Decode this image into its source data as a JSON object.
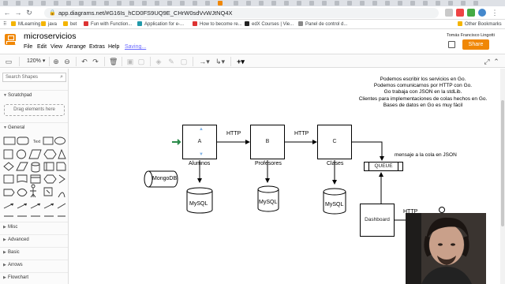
{
  "browser": {
    "url": "app.diagrams.net/#G16Is_hCD0FS9UQ9E_CHrW0sdVvWJtNQ4X",
    "bookmarks": [
      "MLearning",
      "java",
      "bet",
      "Fun with Function...",
      "Application for e-...",
      "How to become re...",
      "edX Courses | Vie...",
      "Panel de control d..."
    ],
    "other_bookmarks": "Other Bookmarks"
  },
  "app": {
    "title": "microservicios",
    "menu": [
      "File",
      "Edit",
      "View",
      "Arrange",
      "Extras",
      "Help"
    ],
    "saving": "Saving...",
    "user": "Tomás Francisco Lingotti",
    "share": "Share",
    "zoom": "120%"
  },
  "sidebar": {
    "search_placeholder": "Search Shapes",
    "scratchpad": "Scratchpad",
    "drag_here": "Drag elements here",
    "general": "General",
    "sections": [
      "Misc",
      "Advanced",
      "Basic",
      "Arrows",
      "Flowchart"
    ],
    "text_shape": "Text"
  },
  "diagram": {
    "node_a": "A",
    "node_b": "B",
    "node_c": "C",
    "label_a": "Alumnos",
    "label_b": "Profesores",
    "label_c": "Clases",
    "http_ab": "HTTP",
    "http_bc": "HTTP",
    "http_dash": "HTTP",
    "mongo": "MongoDB",
    "db1": "MySQL",
    "db2": "MySQL",
    "db3": "MySQL",
    "queue": "QUEUE",
    "queue_note": "mensaje a la cola en JSON",
    "dashboard": "Dashboard",
    "notes": [
      "Podemos escribir los servicios en Go.",
      "Podemos comunicarnos por HTTP con Go.",
      "Go trabaja con JSON en la stdLib.",
      "Clientes para implementaciones de colas hechos en Go.",
      "Bases de datos en Go es muy fácil"
    ]
  },
  "colors": {
    "accent": "#f08705",
    "link": "#6a6aff"
  }
}
